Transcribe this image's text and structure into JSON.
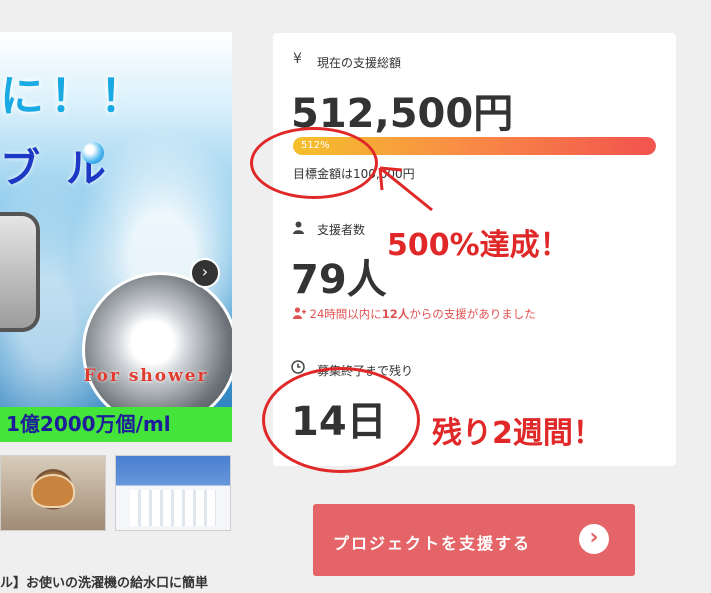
{
  "hero": {
    "headline": "に！！",
    "product_text": "ブ ル",
    "circle_label": "For shower",
    "banner": "1億2000万個/ml",
    "next_arrow": "›"
  },
  "caption": "ル】お使いの洗濯機の給水口に簡単",
  "stats": {
    "total": {
      "icon": "¥",
      "label": "現在の支援総額",
      "value": "512,500円",
      "progress_text": "512%",
      "progress_fraction": 1.0,
      "goal_text": "目標金額は100,000円"
    },
    "supporters": {
      "label": "支援者数",
      "value": "79人",
      "recent_prefix": "24時間以内に",
      "recent_count": "12人",
      "recent_suffix": "からの支援がありました"
    },
    "remaining": {
      "label": "募集終了まで残り",
      "value": "14日"
    }
  },
  "annotations": {
    "achievement": "500%達成！",
    "remaining": "残り2週間！"
  },
  "support_button": {
    "label": "プロジェクトを支援する",
    "arrow": "›"
  },
  "colors": {
    "accent": "#e56468",
    "annotation": "#e02828",
    "recent_text": "#e05252"
  }
}
